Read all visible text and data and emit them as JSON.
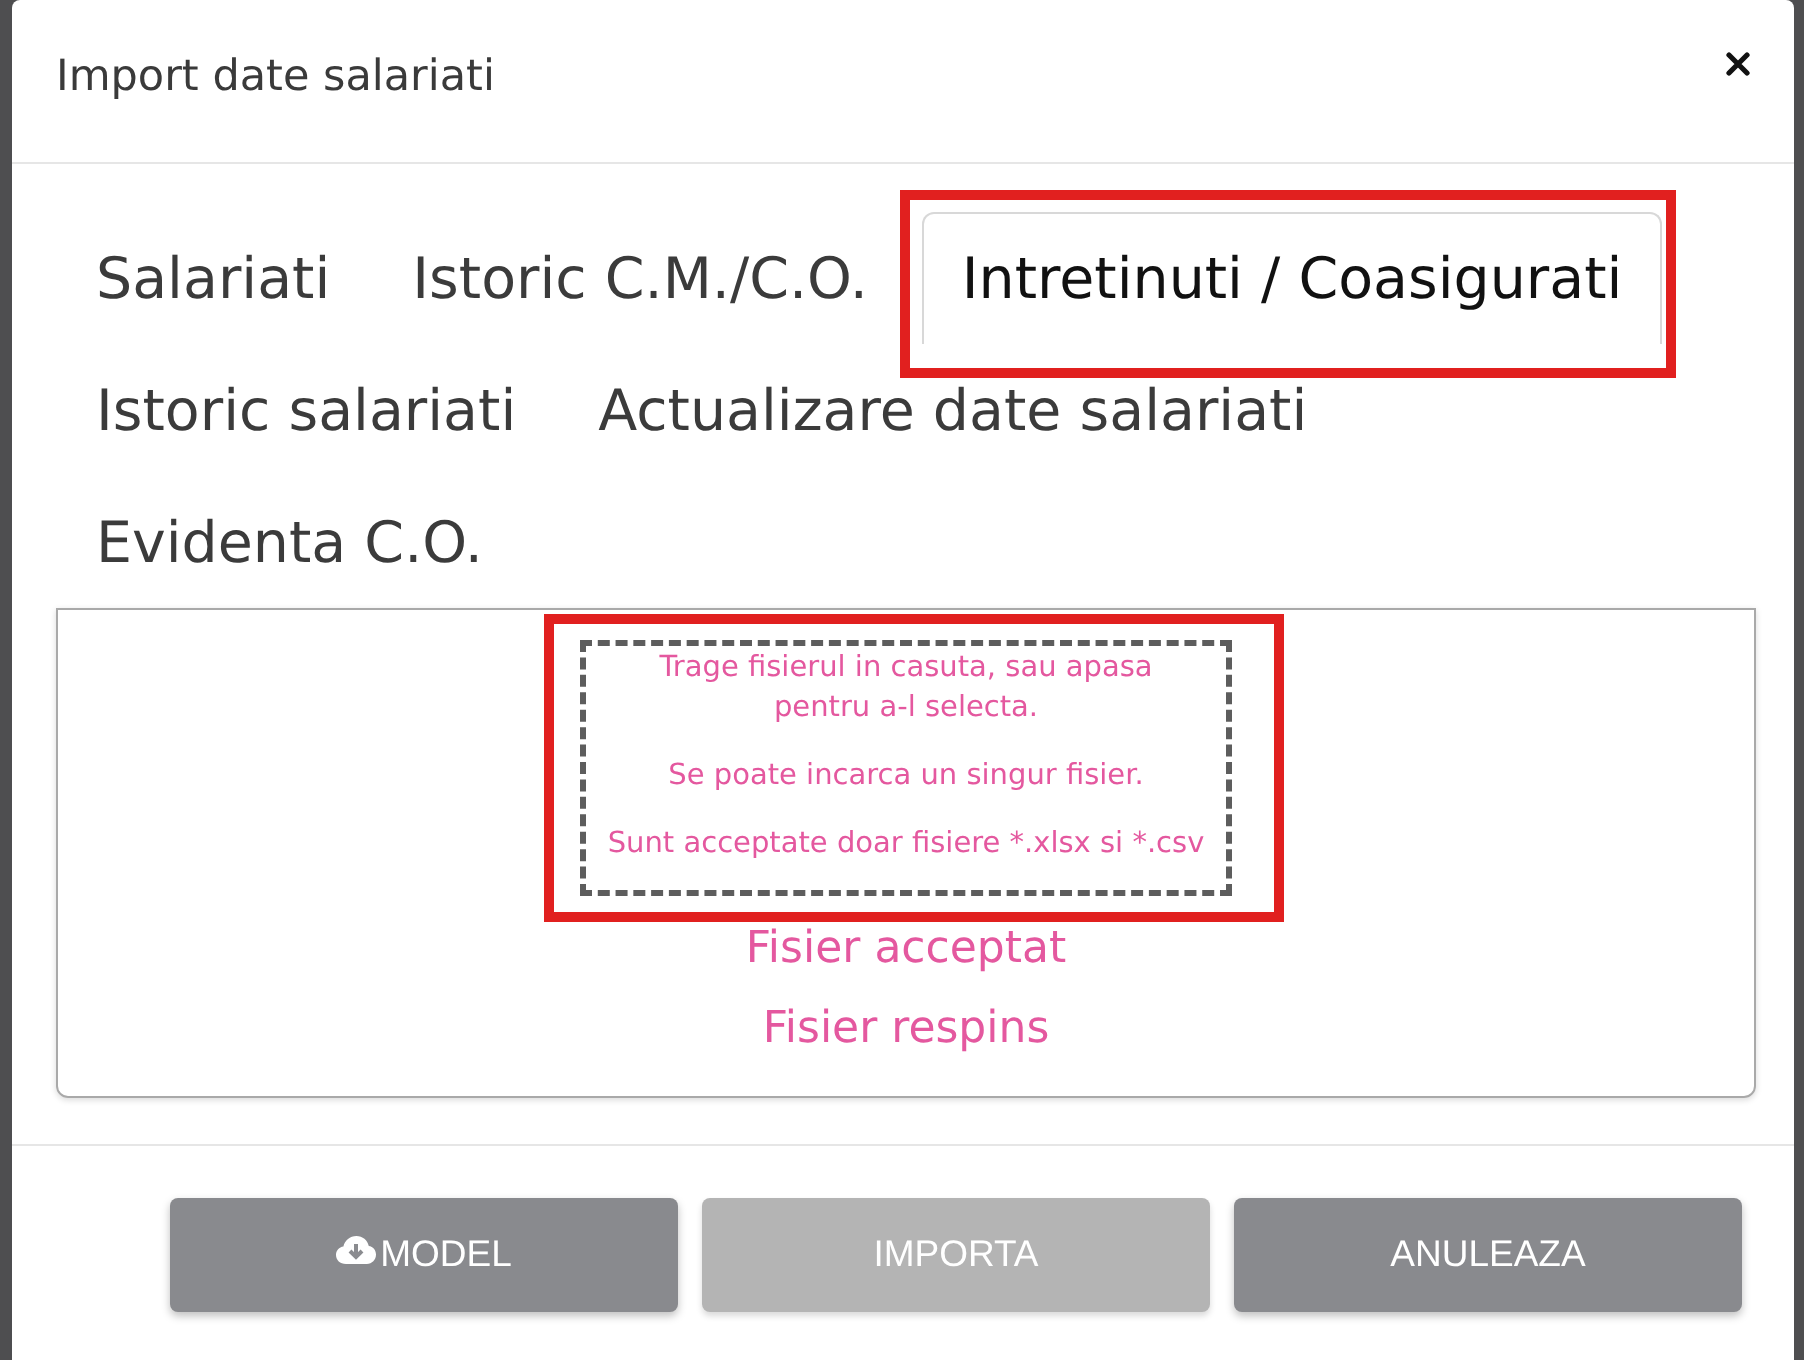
{
  "window": {
    "title": "Import date salariati"
  },
  "tabs": [
    {
      "label": "Salariati",
      "selected": false,
      "highlighted": false
    },
    {
      "label": "Istoric C.M./C.O.",
      "selected": false,
      "highlighted": false
    },
    {
      "label": "Intretinuti / Coasigurati",
      "selected": true,
      "highlighted": true
    },
    {
      "label": "Istoric salariati",
      "selected": false,
      "highlighted": false
    },
    {
      "label": "Actualizare date salariati",
      "selected": false,
      "highlighted": false
    },
    {
      "label": "Evidenta C.O.",
      "selected": false,
      "highlighted": false
    }
  ],
  "dropzone": {
    "highlighted": true,
    "hints": [
      "Trage fisierul in casuta, sau apasa pentru a-l selecta.",
      "Se poate incarca un singur fisier.",
      "Sunt acceptate doar fisiere *.xlsx si *.csv"
    ],
    "messages": [
      "Fisier acceptat",
      "Fisier respins"
    ]
  },
  "buttons": [
    {
      "label": "MODEL",
      "icon": true,
      "disabled": false
    },
    {
      "label": "IMPORTA",
      "icon": false,
      "disabled": true
    },
    {
      "label": "ANULEAZA",
      "icon": false,
      "disabled": false
    }
  ]
}
